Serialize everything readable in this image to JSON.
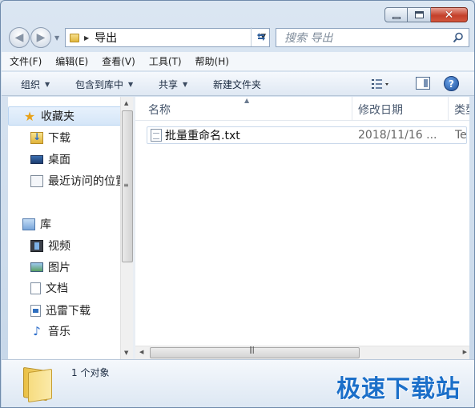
{
  "address": {
    "path": "导出",
    "search_placeholder": "搜索 导出"
  },
  "menu": [
    "文件(F)",
    "编辑(E)",
    "查看(V)",
    "工具(T)",
    "帮助(H)"
  ],
  "toolbar": {
    "organize": "组织",
    "include_in_library": "包含到库中",
    "share": "共享",
    "new_folder": "新建文件夹",
    "help_glyph": "?"
  },
  "navpane": {
    "favorites": "收藏夹",
    "favorites_items": [
      "下载",
      "桌面",
      "最近访问的位置"
    ],
    "libraries": "库",
    "library_items": [
      "视频",
      "图片",
      "文档",
      "迅雷下载",
      "音乐"
    ]
  },
  "columns": {
    "name": "名称",
    "date": "修改日期",
    "type": "类型"
  },
  "files": [
    {
      "name": "批量重命名.txt",
      "date": "2018/11/16 ...",
      "type": "Te"
    }
  ],
  "status": {
    "count": "1 个对象"
  },
  "watermark": "极速下载站",
  "colors": {
    "accent": "#1b6fc9",
    "close_button": "#c4402a",
    "selection": "#d5e6f8"
  }
}
